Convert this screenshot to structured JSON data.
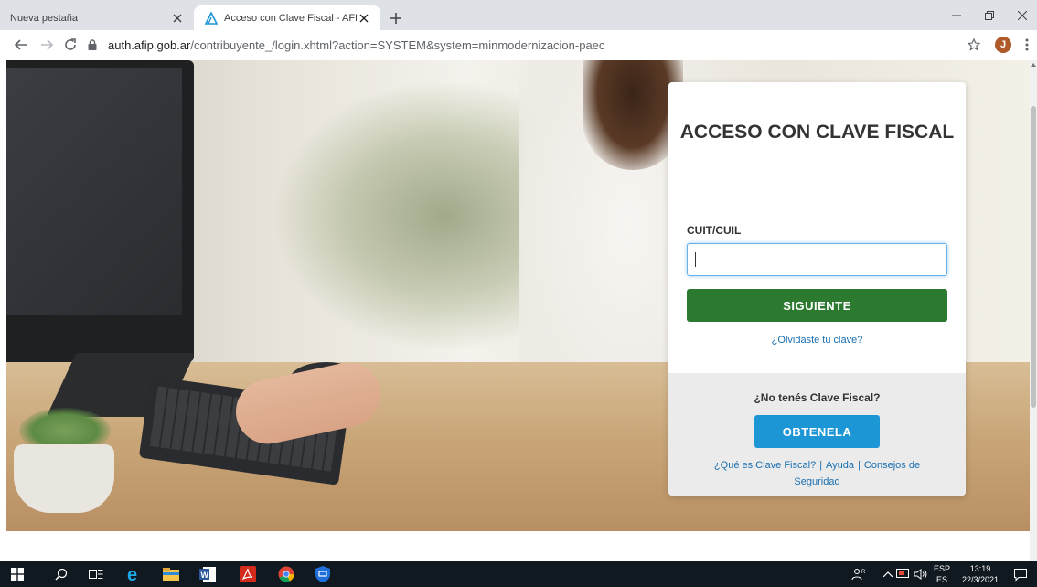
{
  "browser": {
    "tabs": [
      {
        "title": "Nueva pestaña",
        "active": false
      },
      {
        "title": "Acceso con Clave Fiscal - AFIP",
        "active": true
      }
    ],
    "new_tab_label": "+",
    "address": {
      "host": "auth.afip.gob.ar",
      "path": "/contribuyente_/login.xhtml?action=SYSTEM&system=minmodernizacion-paec"
    },
    "profile_initial": "J"
  },
  "login_card": {
    "heading": "ACCESO CON CLAVE FISCAL",
    "cuit_label": "CUIT/CUIL",
    "cuit_value": "",
    "submit_label": "SIGUIENTE",
    "forgot_link": "¿Olvidaste tu clave?",
    "no_account_text": "¿No tenés Clave Fiscal?",
    "get_button_label": "OBTENELA",
    "help_links": {
      "what_is": "¿Qué es Clave Fiscal?",
      "help": "Ayuda",
      "security": "Consejos de Seguridad",
      "separator": "|"
    }
  },
  "colors": {
    "primary_green": "#2b7a30",
    "obtenela_blue": "#1d96d6",
    "link_blue": "#1a6fb0"
  },
  "taskbar": {
    "apps": [
      "windows-start",
      "search",
      "task-view",
      "internet-explorer",
      "file-explorer",
      "word",
      "acrobat",
      "chrome",
      "defender"
    ],
    "language_top": "ESP",
    "language_bottom": "ES",
    "time": "13:19",
    "date": "22/3/2021"
  }
}
